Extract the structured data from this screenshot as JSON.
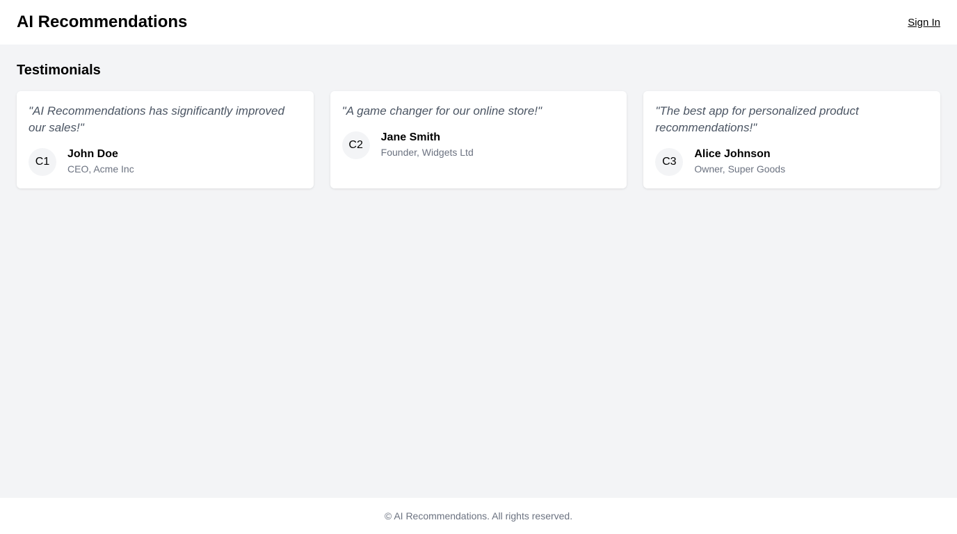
{
  "header": {
    "title": "AI Recommendations",
    "sign_in": "Sign In"
  },
  "section": {
    "title": "Testimonials"
  },
  "testimonials": [
    {
      "quote": "\"AI Recommendations has significantly improved our sales!\"",
      "avatar": "C1",
      "name": "John Doe",
      "role": "CEO, Acme Inc"
    },
    {
      "quote": "\"A game changer for our online store!\"",
      "avatar": "C2",
      "name": "Jane Smith",
      "role": "Founder, Widgets Ltd"
    },
    {
      "quote": "\"The best app for personalized product recommendations!\"",
      "avatar": "C3",
      "name": "Alice Johnson",
      "role": "Owner, Super Goods"
    }
  ],
  "footer": {
    "text": "© AI Recommendations. All rights reserved."
  }
}
